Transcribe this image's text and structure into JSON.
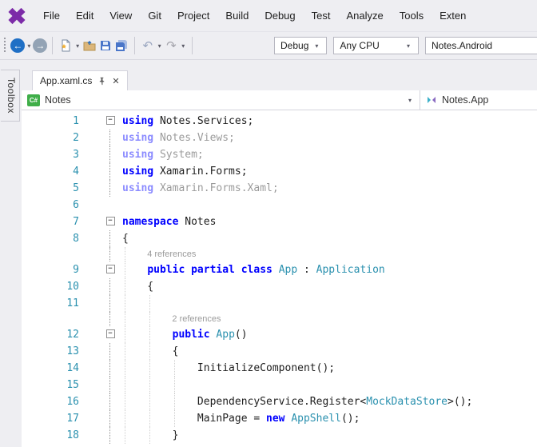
{
  "menu": {
    "items": [
      "File",
      "Edit",
      "View",
      "Git",
      "Project",
      "Build",
      "Debug",
      "Test",
      "Analyze",
      "Tools",
      "Exten"
    ]
  },
  "toolbar": {
    "debug_config": "Debug",
    "platform": "Any CPU",
    "startup_project": "Notes.Android"
  },
  "toolbox": {
    "label": "Toolbox"
  },
  "tabs": [
    {
      "title": "App.xaml.cs"
    }
  ],
  "breadcrumb": {
    "project": "Notes",
    "type": "Notes.App"
  },
  "colors": {
    "chrome": "#eeeef2",
    "accent_purple": "#7c2ba8",
    "keyword": "#0000ff",
    "type": "#2b91af",
    "line_number": "#2b91af",
    "csharp_green": "#3fae49"
  },
  "editor": {
    "rows": [
      {
        "n": "1",
        "fold": true,
        "t": [
          [
            "k",
            "using"
          ],
          [
            "p",
            " Notes.Services;"
          ]
        ]
      },
      {
        "n": "2",
        "fl": true,
        "dim": true,
        "t": [
          [
            "k",
            "using"
          ],
          [
            "p",
            " Notes.Views;"
          ]
        ]
      },
      {
        "n": "3",
        "fl": true,
        "dim": true,
        "t": [
          [
            "k",
            "using"
          ],
          [
            "p",
            " System;"
          ]
        ]
      },
      {
        "n": "4",
        "fl": true,
        "t": [
          [
            "k",
            "using"
          ],
          [
            "p",
            " Xamarin.Forms;"
          ]
        ]
      },
      {
        "n": "5",
        "fl": true,
        "dim": true,
        "t": [
          [
            "k",
            "using"
          ],
          [
            "p",
            " Xamarin.Forms.Xaml;"
          ]
        ]
      },
      {
        "n": "6",
        "t": []
      },
      {
        "n": "7",
        "fold": true,
        "t": [
          [
            "k",
            "namespace"
          ],
          [
            "p",
            " Notes"
          ]
        ]
      },
      {
        "n": "8",
        "fl": true,
        "t": [
          [
            "p",
            "{"
          ]
        ]
      },
      {
        "lens": "4 references",
        "indent": 4,
        "fl": true,
        "guides": [
          0
        ]
      },
      {
        "n": "9",
        "fold": true,
        "guides": [
          0
        ],
        "t": [
          [
            "p",
            "    "
          ],
          [
            "k",
            "public partial class "
          ],
          [
            "y",
            "App"
          ],
          [
            "p",
            " : "
          ],
          [
            "y",
            "Application"
          ]
        ]
      },
      {
        "n": "10",
        "fl": true,
        "guides": [
          0
        ],
        "t": [
          [
            "p",
            "    {"
          ]
        ]
      },
      {
        "n": "11",
        "fl": true,
        "guides": [
          0,
          4
        ],
        "t": []
      },
      {
        "lens": "2 references",
        "indent": 8,
        "fl": true,
        "guides": [
          0,
          4
        ]
      },
      {
        "n": "12",
        "fold": true,
        "guides": [
          0,
          4
        ],
        "t": [
          [
            "p",
            "        "
          ],
          [
            "k",
            "public "
          ],
          [
            "y",
            "App"
          ],
          [
            "p",
            "()"
          ]
        ]
      },
      {
        "n": "13",
        "fl": true,
        "guides": [
          0,
          4
        ],
        "t": [
          [
            "p",
            "        {"
          ]
        ]
      },
      {
        "n": "14",
        "fl": true,
        "guides": [
          0,
          4,
          8
        ],
        "t": [
          [
            "p",
            "            InitializeComponent();"
          ]
        ]
      },
      {
        "n": "15",
        "fl": true,
        "guides": [
          0,
          4,
          8
        ],
        "t": []
      },
      {
        "n": "16",
        "fl": true,
        "guides": [
          0,
          4,
          8
        ],
        "t": [
          [
            "p",
            "            DependencyService.Register<"
          ],
          [
            "y",
            "MockDataStore"
          ],
          [
            "p",
            ">();"
          ]
        ]
      },
      {
        "n": "17",
        "fl": true,
        "guides": [
          0,
          4,
          8
        ],
        "t": [
          [
            "p",
            "            MainPage = "
          ],
          [
            "k",
            "new"
          ],
          [
            "p",
            " "
          ],
          [
            "y",
            "AppShell"
          ],
          [
            "p",
            "();"
          ]
        ]
      },
      {
        "n": "18",
        "fl": true,
        "guides": [
          0,
          4
        ],
        "t": [
          [
            "p",
            "        }"
          ]
        ]
      }
    ]
  }
}
